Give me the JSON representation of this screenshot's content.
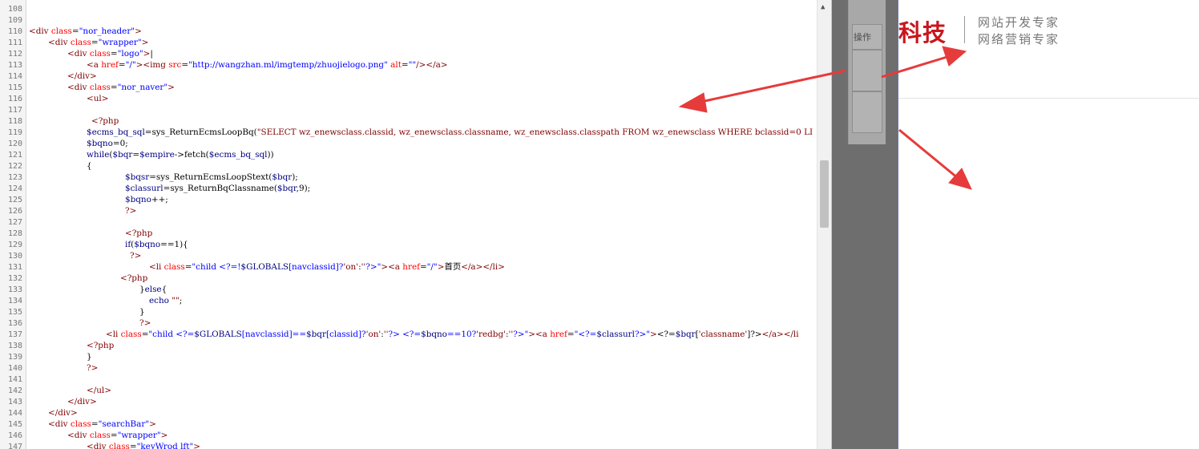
{
  "editor": {
    "line_numbers": [
      "108",
      "109",
      "110",
      "111",
      "112",
      "113",
      "114",
      "115",
      "116",
      "117",
      "118",
      "119",
      "120",
      "121",
      "122",
      "123",
      "124",
      "125",
      "126",
      "127",
      "128",
      "129",
      "130",
      "131",
      "132",
      "133",
      "134",
      "135",
      "136",
      "137",
      "138",
      "139",
      "140",
      "141",
      "142",
      "143",
      "144",
      "145",
      "146",
      "147"
    ]
  },
  "dialog": {
    "operation_label": "操作"
  },
  "site": {
    "brand": "科技",
    "tagline_1": "网站开发专家",
    "tagline_2": "网络营销专家"
  },
  "colors": {
    "brand_red": "#c8161d",
    "annotation_arrow": "#e63b3b"
  }
}
